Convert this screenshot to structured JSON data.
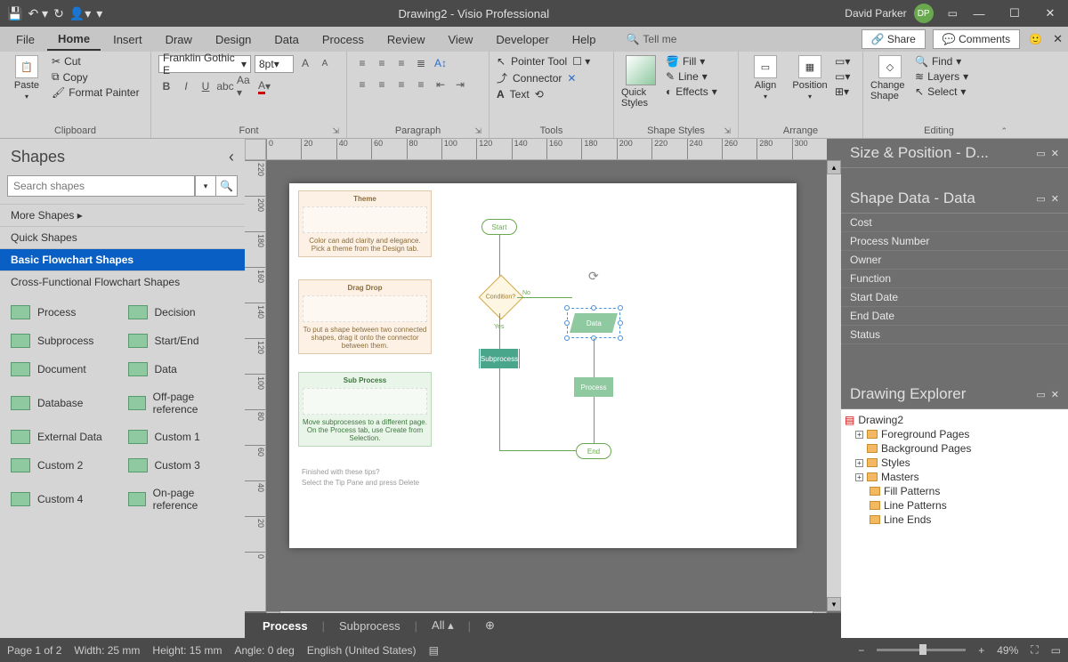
{
  "titlebar": {
    "title": "Drawing2  -  Visio Professional",
    "user_name": "David Parker",
    "user_initials": "DP"
  },
  "menubar": {
    "tabs": [
      "File",
      "Home",
      "Insert",
      "Draw",
      "Design",
      "Data",
      "Process",
      "Review",
      "View",
      "Developer",
      "Help"
    ],
    "active": 1,
    "tellme": "Tell me",
    "share": "Share",
    "comments": "Comments"
  },
  "ribbon": {
    "clipboard": {
      "paste": "Paste",
      "cut": "Cut",
      "copy": "Copy",
      "fmt": "Format Painter",
      "label": "Clipboard"
    },
    "font": {
      "name": "Franklin Gothic E",
      "size": "8pt",
      "label": "Font"
    },
    "paragraph": {
      "label": "Paragraph"
    },
    "tools": {
      "pointer": "Pointer Tool",
      "connector": "Connector",
      "text": "Text",
      "label": "Tools"
    },
    "shapestyles": {
      "quick": "Quick Styles",
      "fill": "Fill",
      "line": "Line",
      "effects": "Effects",
      "label": "Shape Styles"
    },
    "arrange": {
      "align": "Align",
      "position": "Position",
      "label": "Arrange"
    },
    "editing": {
      "change": "Change Shape",
      "find": "Find",
      "layers": "Layers",
      "select": "Select",
      "label": "Editing"
    }
  },
  "shapes": {
    "title": "Shapes",
    "search_ph": "Search shapes",
    "stencils": [
      "More Shapes    ▸",
      "Quick Shapes",
      "Basic Flowchart Shapes",
      "Cross-Functional Flowchart Shapes"
    ],
    "stencil_sel": 2,
    "items": [
      [
        "Process",
        "Decision"
      ],
      [
        "Subprocess",
        "Start/End"
      ],
      [
        "Document",
        "Data"
      ],
      [
        "Database",
        "Off-page reference"
      ],
      [
        "External Data",
        "Custom 1"
      ],
      [
        "Custom 2",
        "Custom 3"
      ],
      [
        "Custom 4",
        "On-page reference"
      ]
    ]
  },
  "canvas": {
    "tips": {
      "theme": {
        "title": "Theme",
        "text": "Color can add clarity and elegance. Pick a theme from the Design tab."
      },
      "drag": {
        "title": "Drag Drop",
        "text": "To put a shape between two connected shapes, drag it onto the connector between them."
      },
      "sub": {
        "title": "Sub Process",
        "text": "Move subprocesses to a different page. On the Process tab, use Create from Selection."
      },
      "done1": "Finished with these tips?",
      "done2": "Select the Tip Pane and press Delete"
    },
    "shapes": {
      "start": "Start",
      "condition": "Condition?",
      "sub": "Subprocess",
      "data": "Data",
      "process": "Process",
      "end": "End",
      "yes": "Yes",
      "no": "No"
    },
    "hruler": [
      "0",
      "20",
      "40",
      "60",
      "80",
      "100",
      "120",
      "140",
      "160",
      "180",
      "200",
      "220",
      "240",
      "260",
      "280",
      "300"
    ],
    "vruler": [
      "220",
      "200",
      "180",
      "160",
      "140",
      "120",
      "100",
      "80",
      "60",
      "40",
      "20",
      "0"
    ]
  },
  "pagetabs": {
    "tabs": [
      "Process",
      "Subprocess",
      "All ▴"
    ],
    "active": 0
  },
  "right": {
    "sizepos": "Size & Position - D...",
    "shapedata_hdr": "Shape Data - Data",
    "shapedata": [
      "Cost",
      "Process Number",
      "Owner",
      "Function",
      "Start Date",
      "End Date",
      "Status"
    ],
    "explorer_hdr": "Drawing Explorer",
    "tree": {
      "root": "Drawing2",
      "nodes": [
        "Foreground Pages",
        "Background Pages",
        "Styles",
        "Masters"
      ],
      "subnodes": [
        "Fill Patterns",
        "Line Patterns",
        "Line Ends"
      ]
    }
  },
  "status": {
    "page": "Page 1 of 2",
    "width": "Width: 25 mm",
    "height": "Height: 15 mm",
    "angle": "Angle: 0 deg",
    "lang": "English (United States)",
    "zoom": "49%"
  }
}
